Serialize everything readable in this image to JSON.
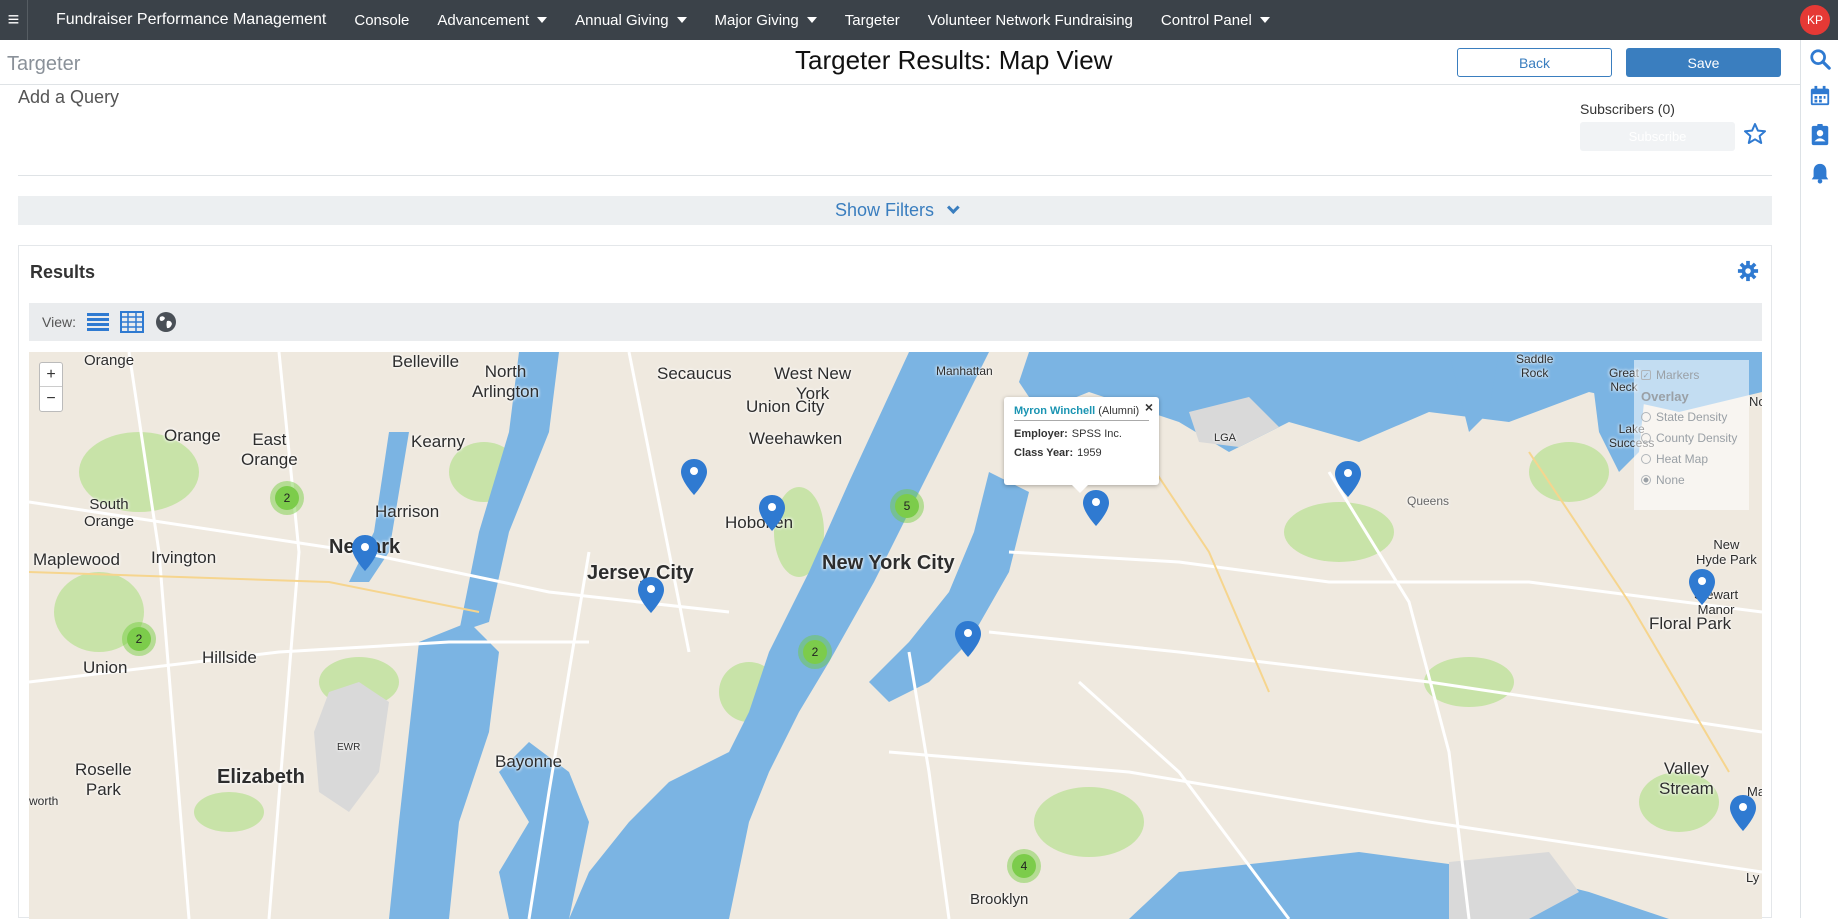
{
  "topnav": {
    "brand": "Fundraiser Performance Management",
    "items": [
      {
        "label": "Console",
        "dropdown": false
      },
      {
        "label": "Advancement",
        "dropdown": true
      },
      {
        "label": "Annual Giving",
        "dropdown": true
      },
      {
        "label": "Major Giving",
        "dropdown": true
      },
      {
        "label": "Targeter",
        "dropdown": false
      },
      {
        "label": "Volunteer Network Fundraising",
        "dropdown": false
      },
      {
        "label": "Control Panel",
        "dropdown": true
      }
    ],
    "avatar_initials": "KP"
  },
  "header": {
    "crumb": "Targeter",
    "title": "Targeter Results: Map View",
    "back_label": "Back",
    "save_label": "Save"
  },
  "query": {
    "add_label": "Add a Query",
    "subscribers_label": "Subscribers (0)",
    "subscribe_label": "Subscribe"
  },
  "filters": {
    "toggle_label": "Show Filters"
  },
  "results": {
    "title": "Results",
    "view_label": "View:"
  },
  "map": {
    "zoom_in": "+",
    "zoom_out": "−",
    "places": {
      "belleville": "Belleville",
      "north_arlington": "North\nArlington",
      "secaucus": "Secaucus",
      "west_new_york": "West New\nYork",
      "manhattan": "Manhattan",
      "union_city": "Union City",
      "weehawken": "Weehawken",
      "orange": "Orange",
      "east_orange": "East\nOrange",
      "kearny": "Kearny",
      "harrison": "Harrison",
      "south_orange": "South\nOrange",
      "newark": "Newark",
      "hoboken": "Hoboken",
      "new_york_city": "New York City",
      "jersey_city": "Jersey City",
      "maplewood": "Maplewood",
      "irvington": "Irvington",
      "union": "Union",
      "hillside": "Hillside",
      "roselle_park": "Roselle\nPark",
      "elizabeth": "Elizabeth",
      "bayonne": "Bayonne",
      "brooklyn": "Brooklyn",
      "queens": "Queens",
      "floral_park": "Floral Park",
      "new_hyde_park": "New\nHyde Park",
      "stewart_manor": "Stewart\nManor",
      "valley_stream": "Valley\nStream",
      "saddle_rock": "Saddle\nRock",
      "great_neck": "Great\nNeck",
      "lake_success": "Lake\nSuccess",
      "lga": "LGA",
      "ewr": "EWR",
      "worth": "worth",
      "ly": "Ly",
      "no": "No",
      "ma": "Ma"
    },
    "clusters": [
      "2",
      "2",
      "5",
      "2",
      "4"
    ],
    "popup": {
      "name": "Myron Winchell",
      "type": "(Alumni)",
      "employer_label": "Employer:",
      "employer": "SPSS Inc.",
      "class_year_label": "Class Year:",
      "class_year": "1959"
    },
    "overlay": {
      "markers_label": "Markers",
      "header": "Overlay",
      "options": [
        "State Density",
        "County Density",
        "Heat Map",
        "None"
      ]
    }
  },
  "colors": {
    "nav_bg": "#3b4249",
    "accent": "#3a7ebf",
    "water": "#7bb4e3",
    "land": "#efe9df",
    "park": "#c8e3a8",
    "marker": "#2f7ad1",
    "cluster": "#7ccc4b"
  },
  "icons": [
    "hamburger-icon",
    "search-icon",
    "calendar-icon",
    "contact-icon",
    "bell-icon",
    "star-icon",
    "gear-icon",
    "list-view-icon",
    "grid-view-icon",
    "globe-view-icon",
    "chevron-down-icon",
    "close-icon",
    "map-marker-icon"
  ]
}
